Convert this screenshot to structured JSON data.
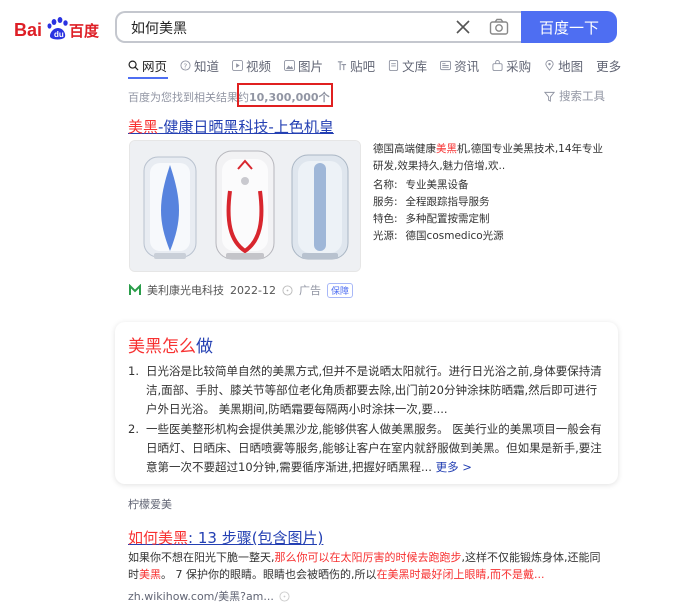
{
  "logo": {
    "text": "Bai百度"
  },
  "search": {
    "query": "如何美黑",
    "button_label": "百度一下"
  },
  "tabs": [
    {
      "label": "网页"
    },
    {
      "label": "知道"
    },
    {
      "label": "视频"
    },
    {
      "label": "图片"
    },
    {
      "label": "贴吧"
    },
    {
      "label": "文库"
    },
    {
      "label": "资讯"
    },
    {
      "label": "采购"
    },
    {
      "label": "地图"
    },
    {
      "label": "更多"
    }
  ],
  "results_info": {
    "prefix": "百度为您找到相关结果约",
    "count": "10,300,000个",
    "tools_label": "搜索工具"
  },
  "ad": {
    "title_hl": "美黑",
    "title_rest": "-健康日晒黑科技-上色机皇",
    "desc_1": "德国高端健康",
    "desc_hl": "美黑",
    "desc_2": "机,德国专业美黑技术,14年专业研发,效果持久,魅力倍增,欢..",
    "rows": [
      {
        "k": "名称:",
        "v": "专业美黑设备"
      },
      {
        "k": "服务:",
        "v": "全程跟踪指导服务"
      },
      {
        "k": "特色:",
        "v": "多种配置按需定制"
      },
      {
        "k": "光源:",
        "v": "德国cosmedico光源"
      }
    ],
    "source": "美利康光电科技",
    "date": "2022-12",
    "ad_label": "广告",
    "badge": "保障"
  },
  "ai_card": {
    "title_hl": "美黑怎么",
    "title_rest": "做",
    "items": [
      {
        "num": "1.",
        "text": "日光浴是比较简单自然的美黑方式,但并不是说晒太阳就行。进行日光浴之前,身体要保持清洁,面部、手肘、膝关节等部位老化角质都要去除,出门前20分钟涂抹防晒霜,然后即可进行户外日光浴。 美黑期间,防晒霜要每隔两小时涂抹一次,要...."
      },
      {
        "num": "2.",
        "text": "一些医美整形机构会提供美黑沙龙,能够供客人做美黑服务。 医美行业的美黑项目一般会有日晒灯、日晒床、日晒喷雾等服务,能够让客户在室内就舒服做到美黑。但如果是新手,要注意第一次不要超过10分钟,需要循序渐进,把握好晒黑程..."
      }
    ],
    "more_label": "更多 >",
    "source": "柠檬爱美"
  },
  "wikihow": {
    "title_hl": "如何美黑",
    "title_rest": ": 13 步骤(包含图片)",
    "desc_1": "如果你不想在阳光下脆一整天,",
    "desc_hl1": "那么你可以在太阳厉害的时候去跑跑步",
    "desc_2": ",这样不仅能锻炼身体,还能同时",
    "desc_hl2": "美黑",
    "desc_3": "。 7 保护你的眼睛。眼睛也会被晒伤的,所以",
    "desc_hl3": "在美黑时最好闭上眼睛,而不是戴...",
    "url": "zh.wikihow.com/美黑?am..."
  },
  "colors": {
    "brand_blue": "#4e6ef2",
    "link_blue": "#2440b3",
    "hl_red": "#f73131",
    "logo_red": "#de1f26"
  }
}
